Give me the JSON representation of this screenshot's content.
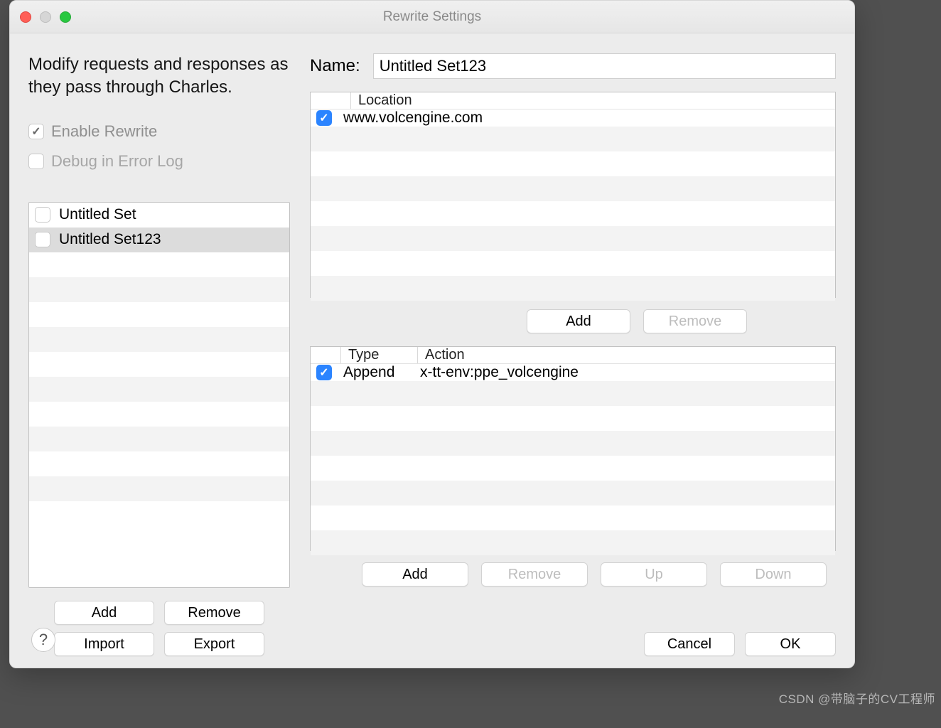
{
  "window": {
    "title": "Rewrite Settings"
  },
  "description": "Modify requests and responses as they pass through Charles.",
  "options": {
    "enable_label": "Enable Rewrite",
    "enable_checked": true,
    "debug_label": "Debug in Error Log",
    "debug_checked": false
  },
  "sets": {
    "items": [
      {
        "label": "Untitled Set",
        "checked": false,
        "selected": false
      },
      {
        "label": "Untitled Set123",
        "checked": false,
        "selected": true
      }
    ],
    "buttons": {
      "add": "Add",
      "remove": "Remove",
      "import": "Import",
      "export": "Export"
    }
  },
  "name": {
    "label": "Name:",
    "value": "Untitled Set123"
  },
  "locations": {
    "header": "Location",
    "rows": [
      {
        "checked": true,
        "location": "www.volcengine.com"
      }
    ],
    "buttons": {
      "add": "Add",
      "remove": "Remove"
    }
  },
  "actions": {
    "headers": {
      "type": "Type",
      "action": "Action"
    },
    "rows": [
      {
        "checked": true,
        "type": "Append",
        "action": "x-tt-env:ppe_volcengine"
      }
    ],
    "buttons": {
      "add": "Add",
      "remove": "Remove",
      "up": "Up",
      "down": "Down"
    }
  },
  "footer": {
    "cancel": "Cancel",
    "ok": "OK"
  },
  "help": "?",
  "watermark": "CSDN @带脑子的CV工程师"
}
